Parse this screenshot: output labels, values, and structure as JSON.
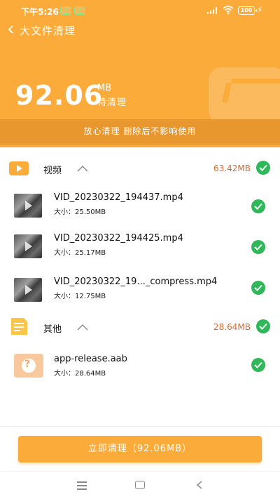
{
  "status_bar": {
    "time": "下午5:26",
    "battery": "100",
    "icons": [
      "notification-icon",
      "notification-icon",
      "signal-icon",
      "wifi-icon",
      "battery-icon",
      "charging-icon"
    ]
  },
  "header": {
    "title": "大文件清理",
    "total_size": "92.06",
    "total_unit": "MB",
    "total_caption": "待清理",
    "banner": "放心清理 删除后不影响使用",
    "colors": {
      "primary": "#fbab3a",
      "banner": "#e8962e"
    }
  },
  "sections": [
    {
      "label": "视频",
      "size": "63.42MB",
      "icon": "video-icon",
      "checked": true,
      "expanded": true,
      "files": [
        {
          "name": "VID_20230322_194437.mp4",
          "size": "大小：25.50MB",
          "checked": true
        },
        {
          "name": "VID_20230322_194425.mp4",
          "size": "大小：25.17MB",
          "checked": true
        },
        {
          "name": "VID_20230322_19..._compress.mp4",
          "size": "大小：12.75MB",
          "checked": true
        }
      ]
    },
    {
      "label": "其他",
      "size": "28.64MB",
      "icon": "document-icon",
      "checked": true,
      "expanded": true,
      "files": [
        {
          "name": "app-release.aab",
          "size": "大小：28.64MB",
          "checked": true
        }
      ]
    }
  ],
  "action": {
    "label": "立即清理（92.06MB）"
  },
  "colors": {
    "accent_size_text": "#d8692f",
    "check_green": "#2fb75a"
  }
}
